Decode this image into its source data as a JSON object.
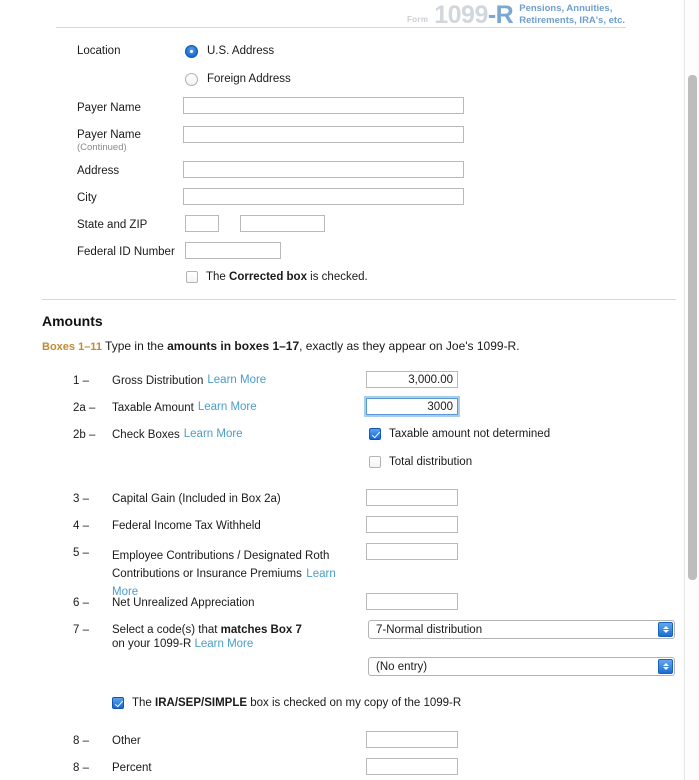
{
  "form_header": {
    "form_word": "Form",
    "number": "1099",
    "number_suffix": "-R",
    "subtitle": "Pensions, Annuities,\nRetirements, IRA's, etc."
  },
  "payer_section": {
    "location_label": "Location",
    "location_options": [
      {
        "label": "U.S. Address",
        "selected": true
      },
      {
        "label": "Foreign Address",
        "selected": false
      }
    ],
    "fields": [
      {
        "label": "Payer Name",
        "sub_label": "",
        "value": ""
      },
      {
        "label": "Payer Name",
        "sub_label": "(Continued)",
        "value": ""
      },
      {
        "label": "Address",
        "sub_label": "",
        "value": ""
      },
      {
        "label": "City",
        "sub_label": "",
        "value": ""
      }
    ],
    "state_zip_label": "State and ZIP",
    "state_value": "",
    "zip_value": "",
    "federal_id_label": "Federal ID Number",
    "federal_id_value": "",
    "corrected_checkbox": {
      "checked": false,
      "text_before": "The ",
      "text_bold": "Corrected box",
      "text_after": " is checked."
    }
  },
  "amounts_section": {
    "title": "Amounts",
    "note_boxes": "Boxes 1–11",
    "note_before": " Type in the ",
    "note_bold": "amounts in boxes 1–17",
    "note_after": ", exactly as they appear on Joe's 1099-R.",
    "learn_more": "Learn More",
    "rows": [
      {
        "num": "1 –",
        "label": "Gross Distribution",
        "link": "Learn More",
        "value": "3,000.00",
        "focused": false
      },
      {
        "num": "2a –",
        "label": "Taxable Amount",
        "link": "Learn More",
        "value": "3000",
        "focused": true
      },
      {
        "num": "2b –",
        "label": "Check Boxes",
        "link": "Learn More",
        "value": "",
        "focused": false
      },
      {
        "num": "3 –",
        "label": "Capital Gain (Included in Box 2a)",
        "link": "",
        "value": "",
        "focused": false
      },
      {
        "num": "4 –",
        "label": "Federal Income Tax Withheld",
        "link": "",
        "value": "",
        "focused": false
      },
      {
        "num": "5 –",
        "label": "Employee Contributions / Designated Roth Contributions or Insurance Premiums",
        "link": "Learn More",
        "value": "",
        "focused": false
      },
      {
        "num": "6 –",
        "label": "Net Unrealized Appreciation",
        "link": "",
        "value": "",
        "focused": false
      },
      {
        "num": "8 –",
        "label": "Other",
        "link": "",
        "value": "",
        "focused": false
      },
      {
        "num": "8 –",
        "label": "Percent",
        "link": "",
        "value": "",
        "focused": false
      }
    ],
    "checkboxes_2b": [
      {
        "label": "Taxable amount not determined",
        "checked": true
      },
      {
        "label": "Total distribution",
        "checked": false
      }
    ],
    "box7": {
      "num": "7 –",
      "line1_before": "Select a code(s) that ",
      "line1_bold": "matches Box 7",
      "line2_before": "on your 1099-R ",
      "line2_link": "Learn More",
      "select1_value": "7-Normal distribution",
      "select2_value": "(No entry)"
    },
    "ira_checkbox": {
      "checked": true,
      "text_before": "The ",
      "text_bold": "IRA/SEP/SIMPLE",
      "text_after": " box is checked on my copy of the 1099-R"
    }
  },
  "scrollbar": {
    "visible": true
  }
}
